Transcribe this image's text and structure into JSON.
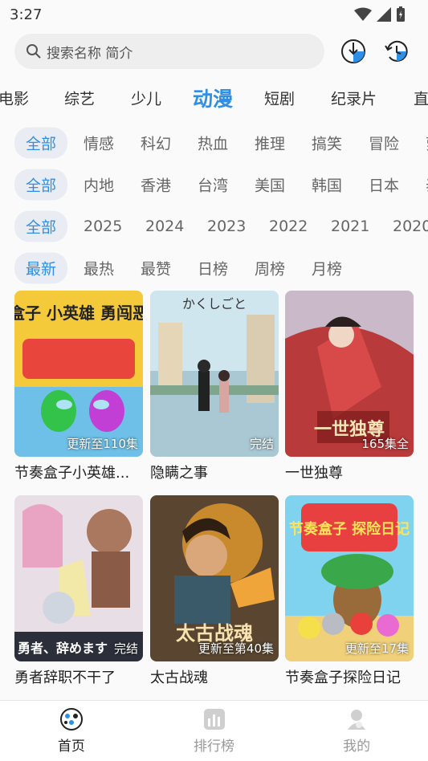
{
  "status": {
    "time": "3:27"
  },
  "search": {
    "placeholder": "搜索名称 简介"
  },
  "categories": [
    "电影",
    "综艺",
    "少儿",
    "动漫",
    "短剧",
    "纪录片",
    "直"
  ],
  "filters": {
    "genre": [
      "全部",
      "情感",
      "科幻",
      "热血",
      "推理",
      "搞笑",
      "冒险",
      "萝"
    ],
    "region": [
      "全部",
      "内地",
      "香港",
      "台湾",
      "美国",
      "韩国",
      "日本",
      "泰"
    ],
    "year": [
      "全部",
      "2025",
      "2024",
      "2023",
      "2022",
      "2021",
      "2020"
    ],
    "sort": [
      "最新",
      "最热",
      "最赞",
      "日榜",
      "周榜",
      "月榜"
    ]
  },
  "items": [
    {
      "title": "节奏盒子小英雄...",
      "badge": "更新至110集",
      "poster_text": "节奏盒子 小英雄 勇闯恶魔关"
    },
    {
      "title": "隐瞒之事",
      "badge": "完结",
      "poster_text": "かくしごと"
    },
    {
      "title": "一世独尊",
      "badge": "165集全",
      "poster_text": "一世独尊"
    },
    {
      "title": "勇者辞职不干了",
      "badge": "完结",
      "poster_text": "勇者、辞めます"
    },
    {
      "title": "太古战魂",
      "badge": "更新至第40集",
      "poster_text": "太古战魂"
    },
    {
      "title": "节奏盒子探险日记",
      "badge": "更新至17集",
      "poster_text": "节奏盒子 探险日记"
    }
  ],
  "nav": [
    "首页",
    "排行榜",
    "我的"
  ],
  "colors": {
    "accent": "#2f8fe6",
    "chip_bg": "#e9edf3"
  }
}
